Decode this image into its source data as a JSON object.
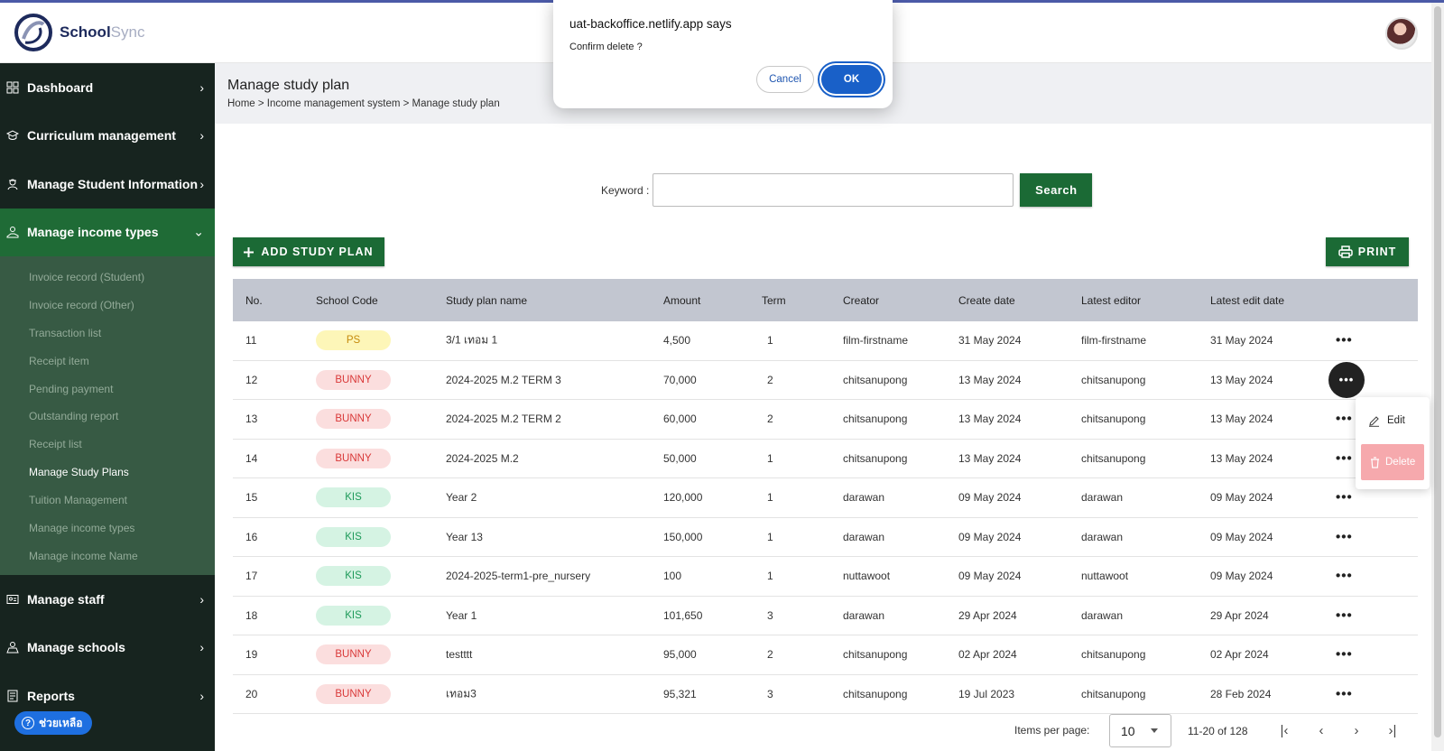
{
  "app": {
    "logo_main": "School",
    "logo_soft": "Sync"
  },
  "sidebar": {
    "items": [
      {
        "label": "Dashboard",
        "icon": "grid-icon",
        "chevron": "›"
      },
      {
        "label": "Curriculum management",
        "icon": "graduation-cap-icon",
        "chevron": "›"
      },
      {
        "label": "Manage Student Information",
        "icon": "student-icon",
        "chevron": "›"
      },
      {
        "label": "Manage income types",
        "icon": "money-hand-icon",
        "chevron": "⌄"
      }
    ],
    "sub_items": [
      "Invoice record (Student)",
      "Invoice record (Other)",
      "Transaction list",
      "Receipt item",
      "Pending payment",
      "Outstanding report",
      "Receipt list",
      "Manage Study Plans",
      "Tuition Management",
      "Manage income types",
      "Manage income Name"
    ],
    "active_sub": "Manage Study Plans",
    "bottom_items": [
      {
        "label": "Manage staff",
        "icon": "id-card-icon",
        "chevron": "›"
      },
      {
        "label": "Manage schools",
        "icon": "school-icon",
        "chevron": "›"
      },
      {
        "label": "Reports",
        "icon": "report-icon",
        "chevron": "›"
      }
    ],
    "help_label": "ช่วยเหลือ"
  },
  "header": {
    "title": "Manage study plan",
    "breadcrumb": "Home > Income management system > Manage study plan"
  },
  "search": {
    "label": "Keyword :",
    "value": "",
    "button": "Search"
  },
  "actions": {
    "add_label": "ADD STUDY PLAN",
    "print_label": "PRINT"
  },
  "table": {
    "columns": [
      "No.",
      "School Code",
      "Study plan name",
      "Amount",
      "Term",
      "Creator",
      "Create date",
      "Latest editor",
      "Latest edit date"
    ],
    "rows": [
      {
        "no": "11",
        "code": "PS",
        "name": "3/1 เทอม 1",
        "amount": "4,500",
        "term": "1",
        "creator": "film-firstname",
        "create_date": "31 May 2024",
        "editor": "film-firstname",
        "edit_date": "31 May 2024"
      },
      {
        "no": "12",
        "code": "BUNNY",
        "name": "2024-2025 M.2 TERM 3",
        "amount": "70,000",
        "term": "2",
        "creator": "chitsanupong",
        "create_date": "13 May 2024",
        "editor": "chitsanupong",
        "edit_date": "13 May 2024"
      },
      {
        "no": "13",
        "code": "BUNNY",
        "name": "2024-2025 M.2 TERM 2",
        "amount": "60,000",
        "term": "2",
        "creator": "chitsanupong",
        "create_date": "13 May 2024",
        "editor": "chitsanupong",
        "edit_date": "13 May 2024"
      },
      {
        "no": "14",
        "code": "BUNNY",
        "name": "2024-2025 M.2",
        "amount": "50,000",
        "term": "1",
        "creator": "chitsanupong",
        "create_date": "13 May 2024",
        "editor": "chitsanupong",
        "edit_date": "13 May 2024"
      },
      {
        "no": "15",
        "code": "KIS",
        "name": "Year 2",
        "amount": "120,000",
        "term": "1",
        "creator": "darawan",
        "create_date": "09 May 2024",
        "editor": "darawan",
        "edit_date": "09 May 2024"
      },
      {
        "no": "16",
        "code": "KIS",
        "name": "Year 13",
        "amount": "150,000",
        "term": "1",
        "creator": "darawan",
        "create_date": "09 May 2024",
        "editor": "darawan",
        "edit_date": "09 May 2024"
      },
      {
        "no": "17",
        "code": "KIS",
        "name": "2024-2025-term1-pre_nursery",
        "amount": "100",
        "term": "1",
        "creator": "nuttawoot",
        "create_date": "09 May 2024",
        "editor": "nuttawoot",
        "edit_date": "09 May 2024"
      },
      {
        "no": "18",
        "code": "KIS",
        "name": "Year 1",
        "amount": "101,650",
        "term": "3",
        "creator": "darawan",
        "create_date": "29 Apr 2024",
        "editor": "darawan",
        "edit_date": "29 Apr 2024"
      },
      {
        "no": "19",
        "code": "BUNNY",
        "name": "testttt",
        "amount": "95,000",
        "term": "2",
        "creator": "chitsanupong",
        "create_date": "02 Apr 2024",
        "editor": "chitsanupong",
        "edit_date": "02 Apr 2024"
      },
      {
        "no": "20",
        "code": "BUNNY",
        "name": "เทอม3",
        "amount": "95,321",
        "term": "3",
        "creator": "chitsanupong",
        "create_date": "19 Jul 2023",
        "editor": "chitsanupong",
        "edit_date": "28 Feb 2024"
      }
    ],
    "more_glyph": "•••"
  },
  "context_menu": {
    "edit": "Edit",
    "delete": "Delete"
  },
  "pagination": {
    "items_per_page_label": "Items per page:",
    "items_per_page": "10",
    "range": "11-20 of 128",
    "first": "|‹",
    "prev": "‹",
    "next": "›",
    "last": "›|"
  },
  "dialog": {
    "title": "uat-backoffice.netlify.app says",
    "message": "Confirm delete ?",
    "cancel": "Cancel",
    "ok": "OK"
  },
  "colors": {
    "sidebar_bg": "#17241f",
    "active_nav": "#1f6b36",
    "primary_green": "#1b6a35",
    "dialog_blue": "#1960c8"
  }
}
